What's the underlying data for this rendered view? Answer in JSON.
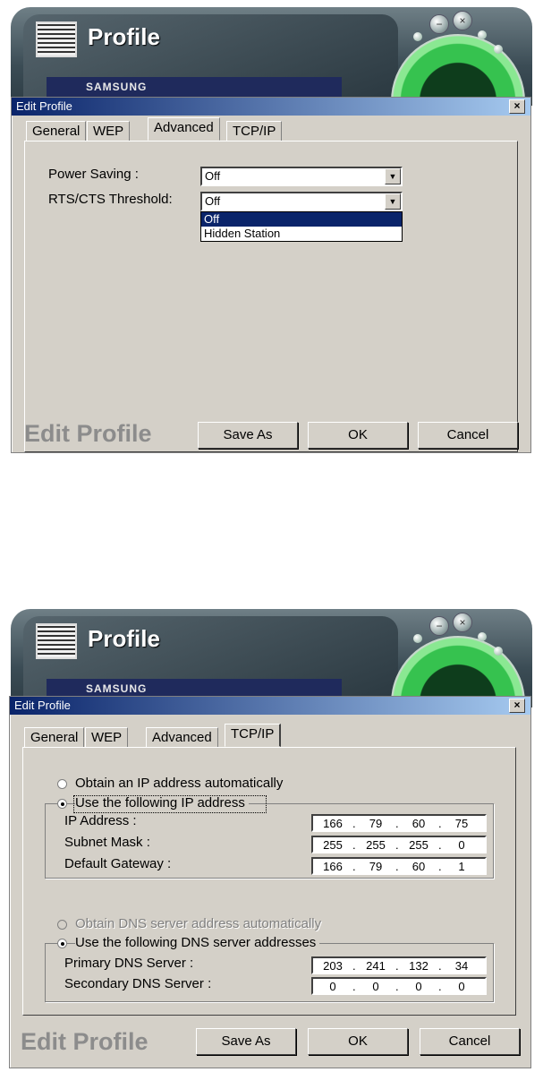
{
  "app": {
    "title": "Profile",
    "brand": "SAMSUNG",
    "controls": [
      "−",
      "×"
    ]
  },
  "dialog_title": "Edit Profile",
  "close_glyph": "×",
  "tabs": [
    "General",
    "WEP",
    "Advanced",
    "TCP/IP"
  ],
  "footer": {
    "title": "Edit Profile",
    "buttons": [
      "Save As",
      "OK",
      "Cancel"
    ]
  },
  "advanced": {
    "active_tab": "Advanced",
    "power_saving": {
      "label": "Power Saving :",
      "value": "Off"
    },
    "rts_cts": {
      "label": "RTS/CTS Threshold:",
      "value": "Off",
      "options": [
        "Off",
        "Hidden Station"
      ],
      "highlighted": "Off"
    }
  },
  "tcpip": {
    "active_tab": "TCP/IP",
    "ip_auto_label": "Obtain an IP address automatically",
    "ip_manual_label": "Use the following IP address",
    "ip_mode": "manual",
    "fields": [
      {
        "label": "IP Address :",
        "octets": [
          "166",
          "79",
          "60",
          "75"
        ]
      },
      {
        "label": "Subnet Mask :",
        "octets": [
          "255",
          "255",
          "255",
          "0"
        ]
      },
      {
        "label": "Default Gateway :",
        "octets": [
          "166",
          "79",
          "60",
          "1"
        ]
      }
    ],
    "dns_auto_label": "Obtain DNS server address automatically",
    "dns_manual_label": "Use the following DNS server addresses",
    "dns_mode": "manual",
    "dns_fields": [
      {
        "label": "Primary DNS Server :",
        "octets": [
          "203",
          "241",
          "132",
          "34"
        ]
      },
      {
        "label": "Secondary DNS Server :",
        "octets": [
          "0",
          "0",
          "0",
          "0"
        ]
      }
    ]
  },
  "colors": {
    "titlebar": "#0a246a",
    "dialog_face": "#d4d0c8",
    "selection": "#0a246a",
    "ring_green": "#36c24f"
  },
  "icons": [
    "app-logo-icon",
    "minimize-icon",
    "close-icon",
    "dropdown-arrow-icon"
  ]
}
